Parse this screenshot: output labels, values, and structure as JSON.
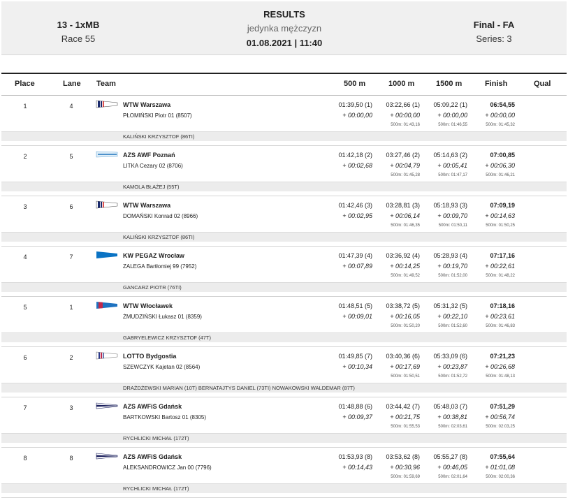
{
  "header": {
    "event_code": "13 - 1xMB",
    "race_number": "Race 55",
    "title": "RESULTS",
    "subtitle": "jedynka mężczyzn",
    "datetime": "01.08.2021 | 11:40",
    "phase": "Final - FA",
    "series": "Series: 3"
  },
  "columns": {
    "place": "Place",
    "lane": "Lane",
    "team": "Team",
    "m500": "500 m",
    "m1000": "1000 m",
    "m1500": "1500 m",
    "finish": "Finish",
    "qual": "Qual"
  },
  "rows": [
    {
      "place": "1",
      "lane": "4",
      "flag": "wtw-warszawa-flag",
      "club": "WTW Warszawa",
      "athlete": "PŁOMIŃSKI  Piotr 01 (8507)",
      "coach": "KALIŃSKI KRZYSZTOF (86TI)",
      "s500": "01:39,50 (1)",
      "d500": "+ 00:00,00",
      "s1000": "03:22,66 (1)",
      "d1000": "+ 00:00,00",
      "p1000": "500m: 01:43,16",
      "s1500": "05:09,22 (1)",
      "d1500": "+ 00:00,00",
      "p1500": "500m: 01:46,55",
      "finish": "06:54,55",
      "dfinish": "+ 00:00,00",
      "pfinish": "500m: 01:45,32"
    },
    {
      "place": "2",
      "lane": "5",
      "flag": "azs-awf-poznan-flag",
      "club": "AZS AWF Poznań",
      "athlete": "LITKA  Cezary 02 (8706)",
      "coach": "KAMOLA BŁAŻEJ (55T)",
      "s500": "01:42,18 (2)",
      "d500": "+ 00:02,68",
      "s1000": "03:27,46 (2)",
      "d1000": "+ 00:04,79",
      "p1000": "500m: 01:45,28",
      "s1500": "05:14,63 (2)",
      "d1500": "+ 00:05,41",
      "p1500": "500m: 01:47,17",
      "finish": "07:00,85",
      "dfinish": "+ 00:06,30",
      "pfinish": "500m: 01:46,21"
    },
    {
      "place": "3",
      "lane": "6",
      "flag": "wtw-warszawa-flag",
      "club": "WTW Warszawa",
      "athlete": "DOMAŃSKI  Konrad 02 (8966)",
      "coach": "KALIŃSKI KRZYSZTOF (86TI)",
      "s500": "01:42,46 (3)",
      "d500": "+ 00:02,95",
      "s1000": "03:28,81 (3)",
      "d1000": "+ 00:06,14",
      "p1000": "500m: 01:46,35",
      "s1500": "05:18,93 (3)",
      "d1500": "+ 00:09,70",
      "p1500": "500m: 01:50,11",
      "finish": "07:09,19",
      "dfinish": "+ 00:14,63",
      "pfinish": "500m: 01:50,25"
    },
    {
      "place": "4",
      "lane": "7",
      "flag": "kw-pegaz-flag",
      "club": "KW PEGAZ Wrocław",
      "athlete": "ZALEGA  Bartłomiej 99 (7952)",
      "coach": "GANCARZ PIOTR (76TI)",
      "s500": "01:47,39 (4)",
      "d500": "+ 00:07,89",
      "s1000": "03:36,92 (4)",
      "d1000": "+ 00:14,25",
      "p1000": "500m: 01:49,52",
      "s1500": "05:28,93 (4)",
      "d1500": "+ 00:19,70",
      "p1500": "500m: 01:52,00",
      "finish": "07:17,16",
      "dfinish": "+ 00:22,61",
      "pfinish": "500m: 01:48,22"
    },
    {
      "place": "5",
      "lane": "1",
      "flag": "wtw-wloclawek-flag",
      "club": "WTW Włocławek",
      "athlete": "ŻMUDZIŃSKI  Łukasz 01 (8359)",
      "coach": "GABRYELEWICZ KRZYSZTOF (47T)",
      "s500": "01:48,51 (5)",
      "d500": "+ 00:09,01",
      "s1000": "03:38,72 (5)",
      "d1000": "+ 00:16,05",
      "p1000": "500m: 01:50,20",
      "s1500": "05:31,32 (5)",
      "d1500": "+ 00:22,10",
      "p1500": "500m: 01:52,60",
      "finish": "07:18,16",
      "dfinish": "+ 00:23,61",
      "pfinish": "500m: 01:46,83"
    },
    {
      "place": "6",
      "lane": "2",
      "flag": "lotto-bydgostia-flag",
      "club": "LOTTO Bydgostia",
      "athlete": "SZEWCZYK  Kajetan 02 (8564)",
      "coach": "DRAŻDŻEWSKI MARIAN (10T) BERNATAJTYS DANIEL (73TI) NOWAKOWSKI WALDEMAR (87T)",
      "s500": "01:49,85 (7)",
      "d500": "+ 00:10,34",
      "s1000": "03:40,36 (6)",
      "d1000": "+ 00:17,69",
      "p1000": "500m: 01:50,51",
      "s1500": "05:33,09 (6)",
      "d1500": "+ 00:23,87",
      "p1500": "500m: 01:52,72",
      "finish": "07:21,23",
      "dfinish": "+ 00:26,68",
      "pfinish": "500m: 01:48,13"
    },
    {
      "place": "7",
      "lane": "3",
      "flag": "azs-awfis-gdansk-flag",
      "club": "AZS AWFiS Gdańsk",
      "athlete": "BARTKOWSKI  Bartosz 01 (8305)",
      "coach": "RYCHLICKI MICHAŁ (172T)",
      "s500": "01:48,88 (6)",
      "d500": "+ 00:09,37",
      "s1000": "03:44,42 (7)",
      "d1000": "+ 00:21,75",
      "p1000": "500m: 01:55,53",
      "s1500": "05:48,03 (7)",
      "d1500": "+ 00:38,81",
      "p1500": "500m: 02:03,61",
      "finish": "07:51,29",
      "dfinish": "+ 00:56,74",
      "pfinish": "500m: 02:03,25"
    },
    {
      "place": "8",
      "lane": "8",
      "flag": "azs-awfis-gdansk-flag",
      "club": "AZS AWFiS Gdańsk",
      "athlete": "ALEKSANDROWICZ  Jan 00 (7796)",
      "coach": "RYCHLICKI MICHAŁ (172T)",
      "s500": "01:53,93 (8)",
      "d500": "+ 00:14,43",
      "s1000": "03:53,62 (8)",
      "d1000": "+ 00:30,96",
      "p1000": "500m: 01:59,69",
      "s1500": "05:55,27 (8)",
      "d1500": "+ 00:46,05",
      "p1500": "500m: 02:01,64",
      "finish": "07:55,64",
      "dfinish": "+ 01:01,08",
      "pfinish": "500m: 02:00,36"
    }
  ]
}
